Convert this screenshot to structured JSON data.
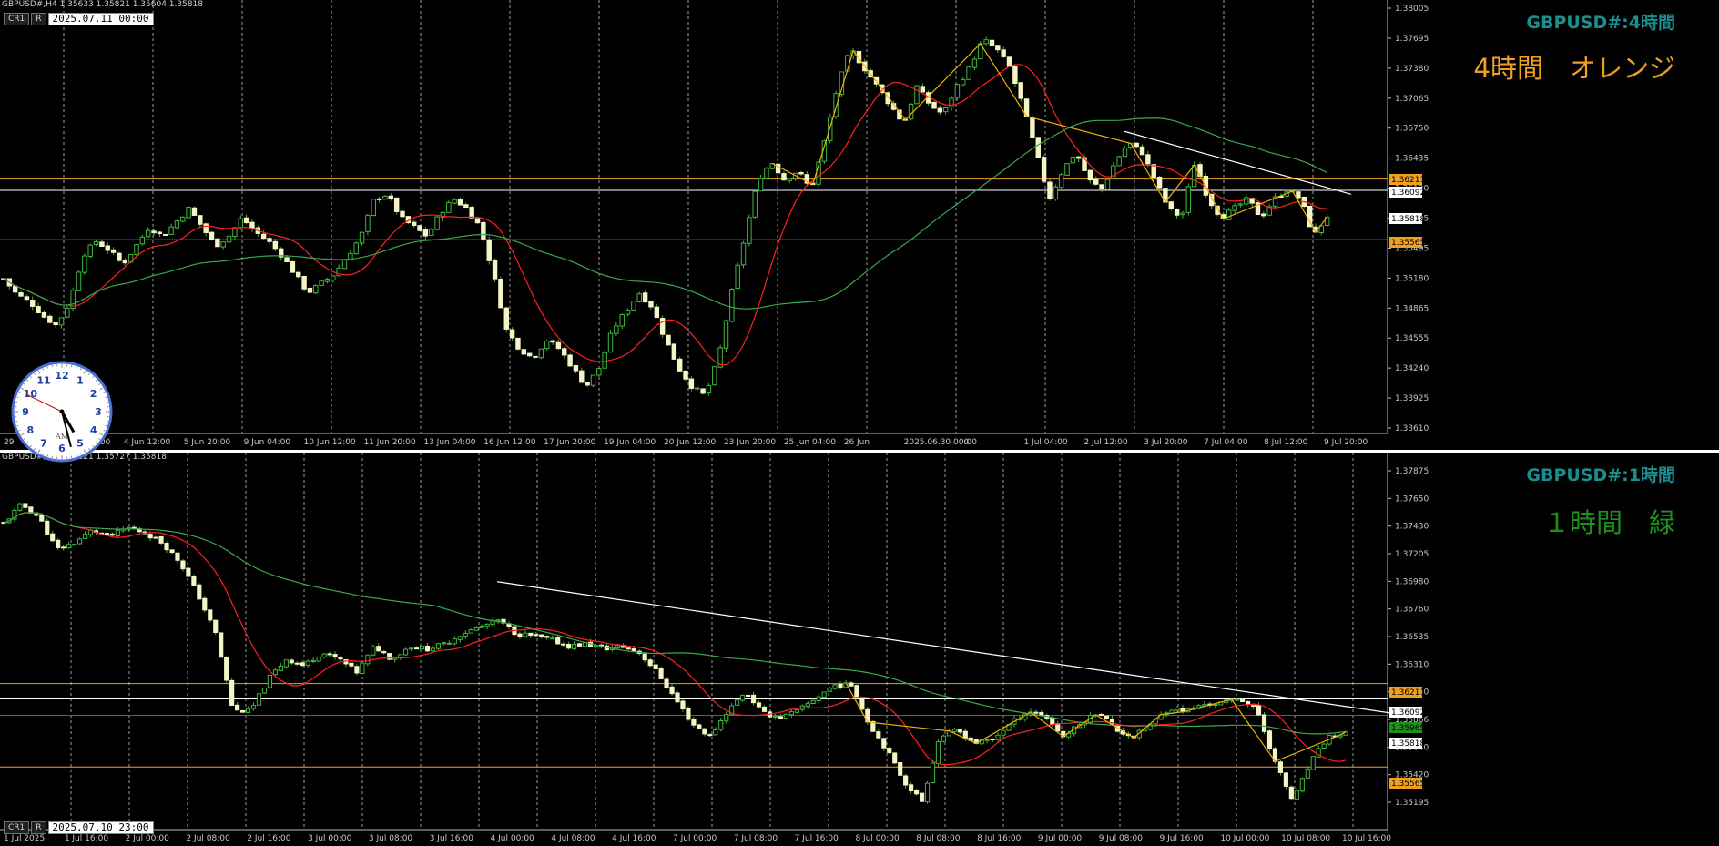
{
  "top_pane": {
    "info": "GBPUSD#,H4  1.35633 1.35821 1.35604 1.35818",
    "buttons": [
      "CR1",
      "R"
    ],
    "time_box": "2025.07.11 00:00",
    "symbol_label": "GBPUSD#:4時間",
    "jp_label": "4時間　オレンジ",
    "jp_color": "#f0a020",
    "price_axis": [
      "1.38005",
      "1.37695",
      "1.37380",
      "1.37065",
      "1.36750",
      "1.36435",
      "1.36120",
      "1.35805",
      "1.35495",
      "1.35180",
      "1.34865",
      "1.34555",
      "1.34240",
      "1.33925",
      "1.33610"
    ],
    "time_axis": [
      "29",
      "3 Jun 04:00",
      "4 Jun 12:00",
      "5 Jun 20:00",
      "9 Jun 04:00",
      "10 Jun 12:00",
      "11 Jun 20:00",
      "13 Jun 04:00",
      "16 Jun 12:00",
      "17 Jun 20:00",
      "19 Jun 04:00",
      "20 Jun 12:00",
      "23 Jun 20:00",
      "25 Jun 04:00",
      "26 Jun",
      "2025.06.30 00:00",
      "0",
      "1 Jul 04:00",
      "2 Jul 12:00",
      "3 Jul 20:00",
      "7 Jul 04:00",
      "8 Jul 12:00",
      "9 Jul 20:00"
    ],
    "price_tags": [
      {
        "text": "1.36211",
        "bg": "#f0a020",
        "fg": "#000000"
      },
      {
        "text": "1.36092",
        "bg": "#ffffff",
        "fg": "#000000"
      },
      {
        "text": "1.35818",
        "bg": "#ffffff",
        "fg": "#000000"
      },
      {
        "text": "1.35565",
        "bg": "#f0a020",
        "fg": "#000000"
      }
    ]
  },
  "bottom_pane": {
    "info": "GBPUSD#,H1  1.35821 1.35727 1.35818",
    "buttons": [
      "CR1",
      "R"
    ],
    "time_box": "2025.07.10 23:00",
    "symbol_label": "GBPUSD#:1時間",
    "jp_label": "１時間　緑",
    "jp_color": "#1f8f1f",
    "price_axis": [
      "1.37875",
      "1.37650",
      "1.37430",
      "1.37205",
      "1.36980",
      "1.36760",
      "1.36535",
      "1.36310",
      "1.36090",
      "1.35866",
      "1.35640",
      "1.35420",
      "1.35195"
    ],
    "time_axis": [
      "1 Jul 2025",
      "1 Jul 16:00",
      "2 Jul 00:00",
      "2 Jul 08:00",
      "2 Jul 16:00",
      "3 Jul 00:00",
      "3 Jul 08:00",
      "3 Jul 16:00",
      "4 Jul 00:00",
      "4 Jul 08:00",
      "4 Jul 16:00",
      "7 Jul 00:00",
      "7 Jul 08:00",
      "7 Jul 16:00",
      "8 Jul 00:00",
      "8 Jul 08:00",
      "8 Jul 16:00",
      "9 Jul 00:00",
      "9 Jul 08:00",
      "9 Jul 16:00",
      "10 Jul 00:00",
      "10 Jul 08:00",
      "10 Jul 16:00"
    ],
    "price_tags": [
      {
        "text": "1.36211",
        "bg": "#f0a020",
        "fg": "#000000"
      },
      {
        "text": "1.36092",
        "bg": "#ffffff",
        "fg": "#000000"
      },
      {
        "text": "1.35965",
        "bg": "#1f8f1f",
        "fg": "#000000"
      },
      {
        "text": "1.35818",
        "bg": "#ffffff",
        "fg": "#000000"
      },
      {
        "text": "1.35565",
        "bg": "#f0a020",
        "fg": "#000000"
      }
    ]
  },
  "clock": {
    "numerals": [
      "12",
      "1",
      "2",
      "3",
      "4",
      "5",
      "6",
      "7",
      "8",
      "9",
      "10",
      "11"
    ],
    "ampm": "AM",
    "hour": 5,
    "minute": 0
  },
  "chart_data": [
    {
      "type": "candlestick",
      "title": "GBPUSD#:4時間",
      "timeframe": "H4",
      "last_ohlc": {
        "open": 1.35633,
        "high": 1.35821,
        "low": 1.35604,
        "close": 1.35818
      },
      "ylim": [
        1.335,
        1.3812
      ],
      "close_path": [
        1.3515,
        1.3498,
        1.349,
        1.3475,
        1.3465,
        1.349,
        1.354,
        1.3555,
        1.3545,
        1.353,
        1.355,
        1.357,
        1.356,
        1.3575,
        1.359,
        1.357,
        1.355,
        1.356,
        1.358,
        1.3565,
        1.3555,
        1.354,
        1.352,
        1.35,
        1.351,
        1.352,
        1.354,
        1.356,
        1.36,
        1.3605,
        1.358,
        1.357,
        1.356,
        1.3585,
        1.36,
        1.359,
        1.357,
        1.352,
        1.346,
        1.344,
        1.343,
        1.345,
        1.344,
        1.342,
        1.34,
        1.342,
        1.346,
        1.348,
        1.35,
        1.3485,
        1.345,
        1.342,
        1.34,
        1.339,
        1.343,
        1.35,
        1.356,
        1.362,
        1.364,
        1.362,
        1.363,
        1.361,
        1.366,
        1.372,
        1.376,
        1.374,
        1.372,
        1.37,
        1.368,
        1.372,
        1.37,
        1.369,
        1.372,
        1.374,
        1.377,
        1.376,
        1.374,
        1.37,
        1.365,
        1.36,
        1.363,
        1.365,
        1.362,
        1.361,
        1.364,
        1.366,
        1.365,
        1.362,
        1.359,
        1.358,
        1.364,
        1.36,
        1.358,
        1.359,
        1.36,
        1.358,
        1.36,
        1.361,
        1.36,
        1.356,
        1.3582
      ],
      "overlays": {
        "ma_fast_color": "#ff2020",
        "ma_slow_color": "#3aa84a",
        "zigzag_color": "#f0b000",
        "horizontal_levels": [
          {
            "price": 1.36211,
            "color": "#f0a020"
          },
          {
            "price": 1.36092,
            "color": "#ffffff"
          },
          {
            "price": 1.35565,
            "color": "#f0a020"
          }
        ],
        "trendline": {
          "from": [
            63,
            1.3672
          ],
          "to": [
            100,
            1.3605
          ],
          "color": "#ffffff"
        }
      },
      "xtick_labels": [
        "29",
        "3 Jun 04:00",
        "4 Jun 12:00",
        "5 Jun 20:00",
        "9 Jun 04:00",
        "10 Jun 12:00",
        "11 Jun 20:00",
        "13 Jun 04:00",
        "16 Jun 12:00",
        "17 Jun 20:00",
        "19 Jun 04:00",
        "20 Jun 12:00",
        "23 Jun 20:00",
        "25 Jun 04:00",
        "26 Jun",
        "1 Jul 04:00",
        "2 Jul 12:00",
        "3 Jul 20:00",
        "7 Jul 04:00",
        "8 Jul 12:00",
        "9 Jul 20:00"
      ],
      "ytick_labels": [
        "1.38005",
        "1.37695",
        "1.37380",
        "1.37065",
        "1.36750",
        "1.36435",
        "1.36120",
        "1.35805",
        "1.35495",
        "1.35180",
        "1.34865",
        "1.34555",
        "1.34240",
        "1.33925",
        "1.33610"
      ]
    },
    {
      "type": "candlestick",
      "title": "GBPUSD#:1時間",
      "timeframe": "H1",
      "last_ohlc": {
        "high": 1.35821,
        "low": 1.35727,
        "close": 1.35818
      },
      "ylim": [
        1.3508,
        1.38
      ],
      "close_path": [
        1.3745,
        1.376,
        1.375,
        1.3725,
        1.373,
        1.374,
        1.3735,
        1.3742,
        1.3738,
        1.373,
        1.3715,
        1.369,
        1.366,
        1.36,
        1.36,
        1.3625,
        1.364,
        1.3635,
        1.3645,
        1.364,
        1.363,
        1.365,
        1.364,
        1.365,
        1.3648,
        1.3652,
        1.366,
        1.3665,
        1.367,
        1.366,
        1.3658,
        1.3655,
        1.365,
        1.3652,
        1.3648,
        1.365,
        1.3645,
        1.363,
        1.361,
        1.359,
        1.358,
        1.36,
        1.3615,
        1.3598,
        1.3595,
        1.36,
        1.361,
        1.362,
        1.362,
        1.359,
        1.357,
        1.3545,
        1.353,
        1.358,
        1.3585,
        1.3575,
        1.3578,
        1.359,
        1.36,
        1.3596,
        1.358,
        1.359,
        1.36,
        1.3585,
        1.358,
        1.359,
        1.3602,
        1.36,
        1.3605,
        1.3606,
        1.361,
        1.36,
        1.356,
        1.353,
        1.356,
        1.358,
        1.3582
      ],
      "overlays": {
        "ma_fast_color": "#ff2020",
        "ma_slow_color": "#3aa84a",
        "zigzag_color": "#f0b000",
        "horizontal_levels": [
          {
            "price": 1.36211,
            "color": "#f0a020"
          },
          {
            "price": 1.36092,
            "color": "#ffffff"
          },
          {
            "price": 1.35965,
            "color": "#1f8f1f"
          },
          {
            "price": 1.35565,
            "color": "#f0a020"
          }
        ],
        "trendline": {
          "from": [
            0.27,
            1.37
          ],
          "to": [
            0.8,
            1.3598
          ],
          "color": "#ffffff"
        }
      },
      "xtick_labels": [
        "1 Jul 2025",
        "1 Jul 16:00",
        "2 Jul 00:00",
        "2 Jul 08:00",
        "2 Jul 16:00",
        "3 Jul 00:00",
        "3 Jul 08:00",
        "3 Jul 16:00",
        "4 Jul 00:00",
        "4 Jul 08:00",
        "4 Jul 16:00",
        "7 Jul 00:00",
        "7 Jul 08:00",
        "7 Jul 16:00",
        "8 Jul 00:00",
        "8 Jul 08:00",
        "8 Jul 16:00",
        "9 Jul 00:00",
        "9 Jul 08:00",
        "9 Jul 16:00",
        "10 Jul 00:00",
        "10 Jul 08:00",
        "10 Jul 16:00"
      ],
      "ytick_labels": [
        "1.37875",
        "1.37650",
        "1.37430",
        "1.37205",
        "1.36980",
        "1.36760",
        "1.36535",
        "1.36310",
        "1.36090",
        "1.35866",
        "1.35640",
        "1.35420",
        "1.35195"
      ]
    }
  ]
}
